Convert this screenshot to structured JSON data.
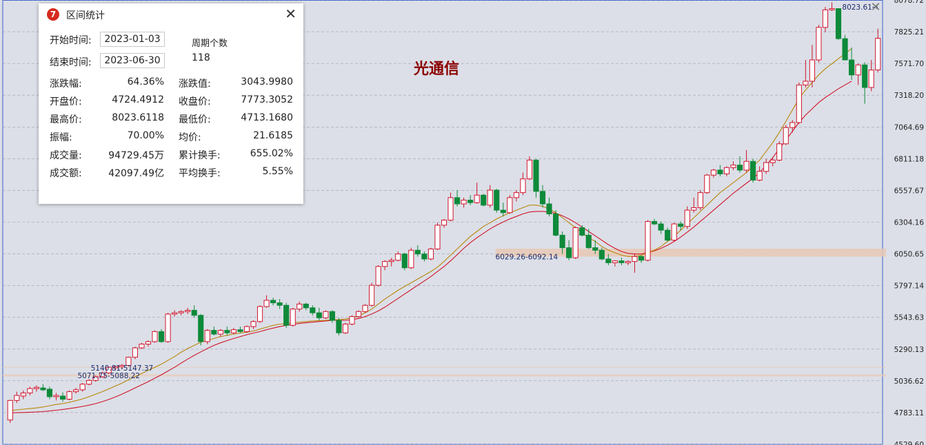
{
  "stock_name": "光通信",
  "close_icon": "close-icon",
  "dialog": {
    "title": "区间统计",
    "logo_icon": "app-logo-icon",
    "start_label": "开始时间:",
    "start_value": "2023-01-03",
    "end_label": "结束时间:",
    "end_value": "2023-06-30",
    "period_label": "周期个数",
    "period_value": "118",
    "rows": [
      {
        "l1": "涨跌幅:",
        "v1": "64.36%",
        "l2": "涨跌值:",
        "v2": "3043.9980"
      },
      {
        "l1": "开盘价:",
        "v1": "4724.4912",
        "l2": "收盘价:",
        "v2": "7773.3052"
      },
      {
        "l1": "最高价:",
        "v1": "8023.6118",
        "l2": "最低价:",
        "v2": "4713.1680"
      },
      {
        "l1": "振幅:",
        "v1": "70.00%",
        "l2": "均价:",
        "v2": "21.6185"
      },
      {
        "l1": "成交量:",
        "v1": "94729.45万",
        "l2": "累计换手:",
        "v2": "655.02%"
      },
      {
        "l1": "成交额:",
        "v1": "42097.49亿",
        "l2": "平均换手:",
        "v2": "5.55%"
      }
    ]
  },
  "colors": {
    "background": "#dcdfe7",
    "up": "#d0142c",
    "down": "#0e8a3a",
    "ma_short": "#b8860b",
    "ma_long": "#d0142c",
    "zone": "#e8c9b4"
  },
  "chart_data": {
    "type": "candlestick",
    "y_ticks": [
      "8078.72",
      "7825.21",
      "7571.70",
      "7318.20",
      "7064.69",
      "6811.18",
      "6557.67",
      "6304.16",
      "6050.65",
      "5797.14",
      "5543.63",
      "5290.13",
      "5036.62",
      "4783.11",
      "4529.60"
    ],
    "ylim": [
      4529.6,
      8078.72
    ],
    "annotations": [
      {
        "text": "8023.61→",
        "x": 99.5,
        "y": 8023.61
      },
      {
        "text": "5140.81-5147.37",
        "x": 10,
        "y": 5140
      },
      {
        "text": "5071.75-5088.22",
        "x": 8.5,
        "y": 5080
      },
      {
        "text": "6029.26-6092.14",
        "x": 56,
        "y": 6029
      }
    ],
    "zones": [
      {
        "from": 6029.26,
        "to": 6092.14,
        "x_start": 56
      },
      {
        "from": 5071.75,
        "to": 5088.22,
        "x_start": 0
      },
      {
        "from": 5140.81,
        "to": 5147.37,
        "x_start": 0
      }
    ],
    "candles": [
      [
        4724,
        4885,
        4700,
        4880
      ],
      [
        4880,
        4950,
        4860,
        4920
      ],
      [
        4915,
        4960,
        4890,
        4940
      ],
      [
        4940,
        4990,
        4920,
        4975
      ],
      [
        4975,
        5000,
        4950,
        4985
      ],
      [
        4980,
        5010,
        4955,
        4965
      ],
      [
        4970,
        4990,
        4890,
        4910
      ],
      [
        4910,
        4940,
        4880,
        4920
      ],
      [
        4915,
        4945,
        4870,
        4890
      ],
      [
        4890,
        4960,
        4880,
        4950
      ],
      [
        4950,
        4980,
        4935,
        4965
      ],
      [
        4965,
        5020,
        4950,
        5010
      ],
      [
        5010,
        5050,
        5000,
        5040
      ],
      [
        5040,
        5080,
        5030,
        5070
      ],
      [
        5070,
        5110,
        5060,
        5100
      ],
      [
        5100,
        5150,
        5090,
        5145
      ],
      [
        5140,
        5160,
        5120,
        5150
      ],
      [
        5150,
        5170,
        5130,
        5160
      ],
      [
        5160,
        5230,
        5150,
        5225
      ],
      [
        5225,
        5310,
        5210,
        5300
      ],
      [
        5300,
        5340,
        5290,
        5330
      ],
      [
        5330,
        5360,
        5310,
        5350
      ],
      [
        5350,
        5440,
        5340,
        5430
      ],
      [
        5430,
        5450,
        5340,
        5350
      ],
      [
        5350,
        5580,
        5340,
        5570
      ],
      [
        5570,
        5600,
        5550,
        5580
      ],
      [
        5580,
        5600,
        5560,
        5590
      ],
      [
        5590,
        5620,
        5570,
        5600
      ],
      [
        5600,
        5640,
        5540,
        5560
      ],
      [
        5560,
        5570,
        5320,
        5350
      ],
      [
        5350,
        5450,
        5330,
        5440
      ],
      [
        5440,
        5470,
        5400,
        5410
      ],
      [
        5410,
        5450,
        5390,
        5440
      ],
      [
        5440,
        5470,
        5400,
        5420
      ],
      [
        5420,
        5460,
        5410,
        5445
      ],
      [
        5445,
        5470,
        5420,
        5430
      ],
      [
        5430,
        5480,
        5420,
        5470
      ],
      [
        5470,
        5520,
        5450,
        5510
      ],
      [
        5510,
        5640,
        5500,
        5630
      ],
      [
        5630,
        5720,
        5620,
        5680
      ],
      [
        5680,
        5700,
        5640,
        5660
      ],
      [
        5660,
        5690,
        5610,
        5640
      ],
      [
        5640,
        5660,
        5460,
        5480
      ],
      [
        5480,
        5620,
        5470,
        5610
      ],
      [
        5610,
        5670,
        5590,
        5650
      ],
      [
        5650,
        5660,
        5600,
        5620
      ],
      [
        5620,
        5640,
        5560,
        5580
      ],
      [
        5580,
        5620,
        5520,
        5540
      ],
      [
        5540,
        5600,
        5530,
        5590
      ],
      [
        5590,
        5600,
        5500,
        5520
      ],
      [
        5520,
        5540,
        5400,
        5420
      ],
      [
        5420,
        5500,
        5410,
        5490
      ],
      [
        5490,
        5560,
        5480,
        5550
      ],
      [
        5550,
        5600,
        5540,
        5590
      ],
      [
        5590,
        5650,
        5580,
        5640
      ],
      [
        5640,
        5820,
        5630,
        5800
      ],
      [
        5800,
        5960,
        5790,
        5950
      ],
      [
        5950,
        6000,
        5920,
        5990
      ],
      [
        5990,
        6020,
        5950,
        6000
      ],
      [
        6000,
        6070,
        5990,
        6050
      ],
      [
        6050,
        6060,
        5920,
        5940
      ],
      [
        5940,
        6100,
        5930,
        6080
      ],
      [
        6080,
        6120,
        6030,
        6050
      ],
      [
        6050,
        6070,
        5990,
        6010
      ],
      [
        6010,
        6100,
        6000,
        6090
      ],
      [
        6090,
        6300,
        6080,
        6280
      ],
      [
        6280,
        6330,
        6260,
        6320
      ],
      [
        6320,
        6540,
        6310,
        6500
      ],
      [
        6500,
        6560,
        6430,
        6450
      ],
      [
        6450,
        6500,
        6420,
        6480
      ],
      [
        6480,
        6520,
        6440,
        6460
      ],
      [
        6460,
        6620,
        6450,
        6520
      ],
      [
        6520,
        6530,
        6430,
        6440
      ],
      [
        6440,
        6600,
        6420,
        6560
      ],
      [
        6560,
        6570,
        6380,
        6400
      ],
      [
        6400,
        6460,
        6350,
        6380
      ],
      [
        6380,
        6520,
        6370,
        6500
      ],
      [
        6500,
        6560,
        6470,
        6540
      ],
      [
        6540,
        6700,
        6520,
        6650
      ],
      [
        6650,
        6830,
        6640,
        6800
      ],
      [
        6800,
        6810,
        6500,
        6550
      ],
      [
        6550,
        6600,
        6420,
        6450
      ],
      [
        6450,
        6500,
        6350,
        6370
      ],
      [
        6370,
        6400,
        6190,
        6200
      ],
      [
        6200,
        6230,
        6050,
        6100
      ],
      [
        6100,
        6160,
        6000,
        6020
      ],
      [
        6020,
        6270,
        6010,
        6260
      ],
      [
        6260,
        6280,
        6190,
        6200
      ],
      [
        6200,
        6250,
        6090,
        6100
      ],
      [
        6100,
        6160,
        6050,
        6080
      ],
      [
        6080,
        6100,
        6000,
        6010
      ],
      [
        6010,
        6050,
        5960,
        5980
      ],
      [
        5980,
        6000,
        5950,
        5995
      ],
      [
        5995,
        6020,
        5960,
        5980
      ],
      [
        5980,
        6000,
        5960,
        5990
      ],
      [
        5990,
        6050,
        5900,
        6030
      ],
      [
        6030,
        6040,
        5980,
        6000
      ],
      [
        6000,
        6320,
        5990,
        6310
      ],
      [
        6310,
        6330,
        6280,
        6290
      ],
      [
        6290,
        6310,
        6210,
        6240
      ],
      [
        6240,
        6260,
        6150,
        6160
      ],
      [
        6160,
        6300,
        6150,
        6290
      ],
      [
        6290,
        6310,
        6240,
        6270
      ],
      [
        6270,
        6430,
        6250,
        6400
      ],
      [
        6400,
        6500,
        6380,
        6420
      ],
      [
        6420,
        6560,
        6400,
        6540
      ],
      [
        6540,
        6690,
        6530,
        6680
      ],
      [
        6680,
        6730,
        6660,
        6720
      ],
      [
        6720,
        6760,
        6670,
        6690
      ],
      [
        6690,
        6750,
        6670,
        6740
      ],
      [
        6740,
        6790,
        6720,
        6760
      ],
      [
        6760,
        6830,
        6700,
        6720
      ],
      [
        6720,
        6880,
        6700,
        6790
      ],
      [
        6790,
        6810,
        6620,
        6640
      ],
      [
        6640,
        6750,
        6630,
        6710
      ],
      [
        6710,
        6810,
        6690,
        6780
      ],
      [
        6780,
        6820,
        6750,
        6800
      ],
      [
        6800,
        6950,
        6790,
        6930
      ],
      [
        6930,
        7080,
        6920,
        7060
      ],
      [
        7060,
        7120,
        7020,
        7100
      ],
      [
        7100,
        7420,
        7090,
        7400
      ],
      [
        7400,
        7600,
        7380,
        7430
      ],
      [
        7430,
        7720,
        7380,
        7600
      ],
      [
        7600,
        7880,
        7580,
        7860
      ],
      [
        7860,
        8023,
        7820,
        8000
      ],
      [
        8000,
        8060,
        7990,
        8010
      ],
      [
        8010,
        7950,
        7760,
        7770
      ],
      [
        7770,
        7800,
        7600,
        7600
      ],
      [
        7600,
        7700,
        7440,
        7480
      ],
      [
        7480,
        7570,
        7400,
        7560
      ],
      [
        7560,
        7580,
        7250,
        7380
      ],
      [
        7380,
        7600,
        7350,
        7520
      ],
      [
        7520,
        7850,
        7500,
        7773
      ]
    ],
    "ma_short": [
      4800,
      4805,
      4810,
      4815,
      4820,
      4828,
      4838,
      4848,
      4855,
      4865,
      4878,
      4892,
      4910,
      4930,
      4950,
      4972,
      4995,
      5018,
      5045,
      5070,
      5095,
      5120,
      5145,
      5170,
      5200,
      5230,
      5265,
      5295,
      5320,
      5345,
      5360,
      5375,
      5390,
      5400,
      5410,
      5418,
      5425,
      5435,
      5450,
      5465,
      5480,
      5490,
      5495,
      5500,
      5505,
      5510,
      5515,
      5518,
      5520,
      5525,
      5525,
      5530,
      5540,
      5555,
      5580,
      5610,
      5650,
      5690,
      5725,
      5760,
      5790,
      5820,
      5850,
      5880,
      5910,
      5945,
      5990,
      6040,
      6090,
      6140,
      6190,
      6230,
      6270,
      6300,
      6330,
      6355,
      6380,
      6400,
      6420,
      6440,
      6440,
      6430,
      6410,
      6380,
      6340,
      6300,
      6260,
      6220,
      6180,
      6150,
      6110,
      6080,
      6060,
      6040,
      6030,
      6030,
      6040,
      6060,
      6080,
      6110,
      6150,
      6190,
      6240,
      6290,
      6340,
      6390,
      6440,
      6490,
      6540,
      6580,
      6620,
      6660,
      6700,
      6750,
      6800,
      6870,
      6940,
      7020,
      7110,
      7200,
      7290,
      7360,
      7420,
      7480,
      7530,
      7570,
      7610,
      7650,
      7690
    ],
    "ma_long": [
      4780,
      4782,
      4784,
      4786,
      4788,
      4791,
      4796,
      4802,
      4808,
      4815,
      4823,
      4832,
      4842,
      4855,
      4870,
      4888,
      4908,
      4930,
      4955,
      4980,
      5005,
      5030,
      5058,
      5085,
      5115,
      5145,
      5178,
      5210,
      5240,
      5268,
      5295,
      5320,
      5340,
      5358,
      5375,
      5390,
      5405,
      5418,
      5430,
      5445,
      5458,
      5470,
      5480,
      5488,
      5495,
      5500,
      5505,
      5510,
      5515,
      5520,
      5520,
      5520,
      5525,
      5535,
      5550,
      5570,
      5595,
      5625,
      5660,
      5695,
      5730,
      5765,
      5800,
      5835,
      5870,
      5910,
      5950,
      5995,
      6045,
      6095,
      6140,
      6180,
      6215,
      6250,
      6280,
      6305,
      6330,
      6350,
      6370,
      6385,
      6390,
      6390,
      6385,
      6375,
      6355,
      6330,
      6300,
      6265,
      6230,
      6195,
      6160,
      6125,
      6095,
      6070,
      6055,
      6050,
      6050,
      6060,
      6075,
      6095,
      6120,
      6150,
      6185,
      6225,
      6265,
      6310,
      6355,
      6400,
      6445,
      6490,
      6535,
      6575,
      6615,
      6655,
      6700,
      6760,
      6820,
      6890,
      6960,
      7030,
      7100,
      7160,
      7210,
      7260,
      7300,
      7335,
      7370,
      7400,
      7430
    ]
  }
}
